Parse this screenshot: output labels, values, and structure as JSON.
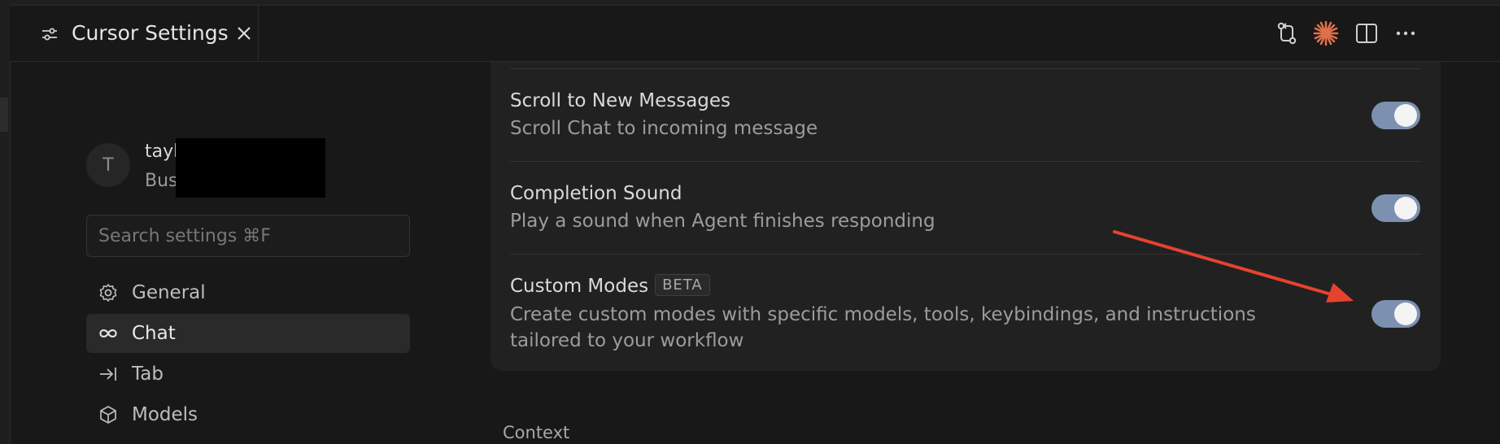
{
  "tab": {
    "title": "Cursor Settings"
  },
  "toolbar": {
    "icons": [
      "source-control-icon",
      "cursor-spark-icon",
      "split-editor-icon",
      "more-icon"
    ]
  },
  "user": {
    "avatar_initial": "T",
    "name": "tayl",
    "plan": "Bus"
  },
  "search": {
    "placeholder": "Search settings ⌘F"
  },
  "nav": {
    "items": [
      {
        "label": "General",
        "icon": "gear-icon",
        "active": false
      },
      {
        "label": "Chat",
        "icon": "infinity-icon",
        "active": true
      },
      {
        "label": "Tab",
        "icon": "tab-arrow-icon",
        "active": false
      },
      {
        "label": "Models",
        "icon": "cube-icon",
        "active": false
      }
    ]
  },
  "settings": {
    "rows": [
      {
        "title": "Scroll to New Messages",
        "description": "Scroll Chat to incoming message",
        "enabled": true
      },
      {
        "title": "Completion Sound",
        "description": "Play a sound when Agent finishes responding",
        "enabled": true
      },
      {
        "title": "Custom Modes",
        "badge": "BETA",
        "description": "Create custom modes with specific models, tools, keybindings, and instructions tailored to your workflow",
        "enabled": true
      }
    ]
  },
  "next_section": {
    "label": "Context"
  },
  "colors": {
    "toggle_on": "#7c90b0",
    "annotation_arrow": "#e5432f",
    "accent_spark": "#e0704a"
  }
}
